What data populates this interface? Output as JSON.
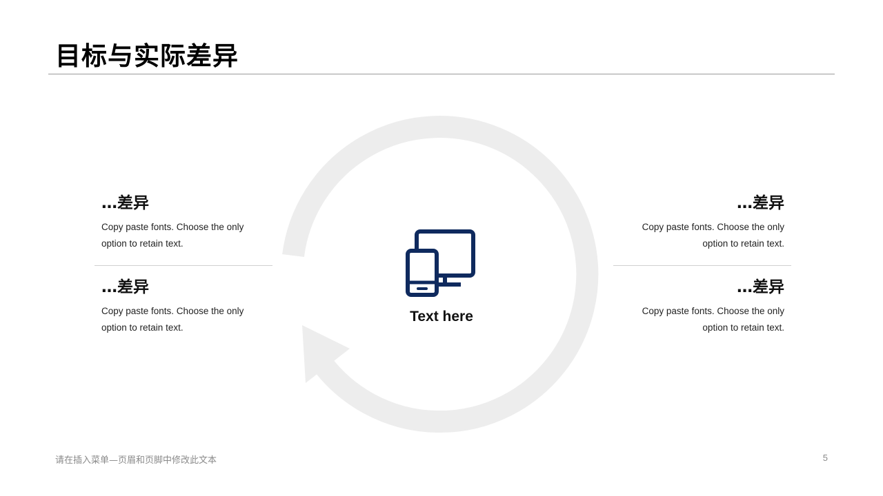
{
  "slide": {
    "title": "目标与实际差异",
    "center_label": "Text here",
    "center_icon": "devices-icon",
    "cycle_icon": "cycle-arrow-icon",
    "items": [
      {
        "heading": "…差异",
        "desc_line1": "Copy paste fonts. Choose the only",
        "desc_line2": "option to retain text."
      },
      {
        "heading": "…差异",
        "desc_line1": "Copy paste fonts. Choose the only",
        "desc_line2": "option to retain text."
      },
      {
        "heading": "…差异",
        "desc_line1": "Copy paste fonts. Choose the only",
        "desc_line2": "option to retain text."
      },
      {
        "heading": "…差异",
        "desc_line1": "Copy paste fonts. Choose the only",
        "desc_line2": "option to retain text."
      }
    ]
  },
  "footer": {
    "text": "请在插入菜单—页眉和页脚中修改此文本",
    "page_number": "5"
  },
  "colors": {
    "icon": "#0f2a5e",
    "cycle": "#ededed",
    "rule": "#9a9a9a"
  }
}
